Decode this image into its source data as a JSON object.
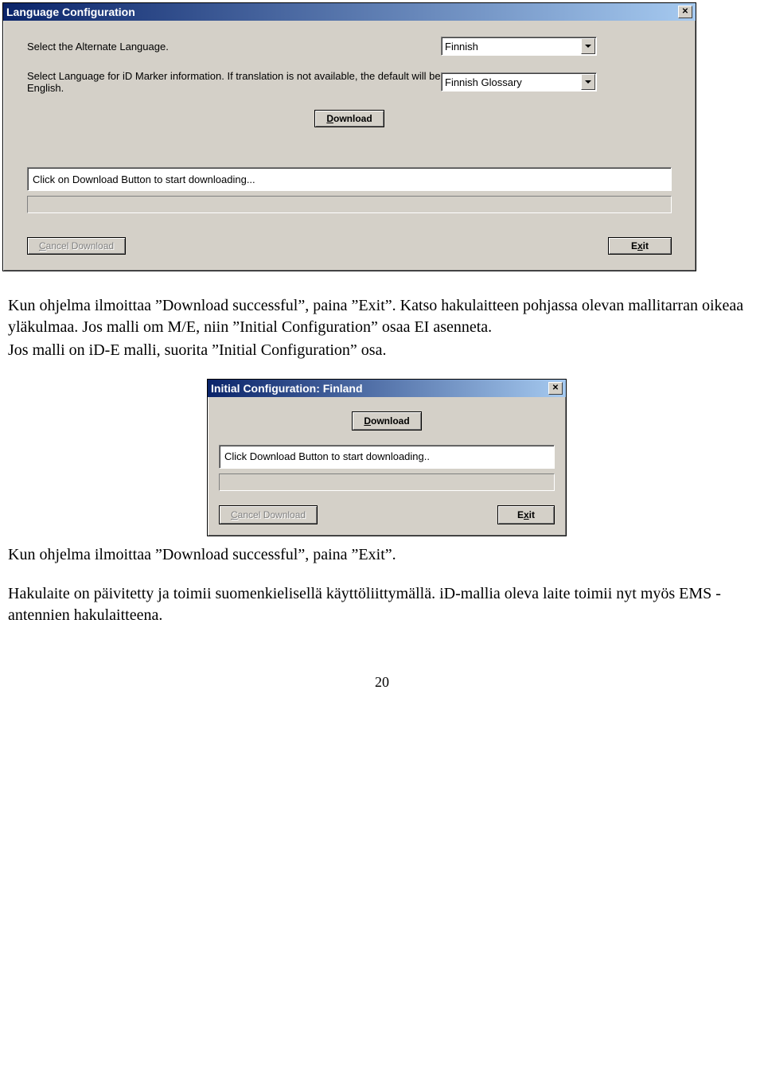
{
  "win1": {
    "title": "Language Configuration",
    "label1": "Select the Alternate Language.",
    "dropdown1": "Finnish",
    "label2": "Select Language for iD Marker information.  If translation is not available, the default will be English.",
    "dropdown2": "Finnish Glossary",
    "download_btn": "ownload",
    "download_btn_prefix": "D",
    "status": "Click on Download Button to start downloading...",
    "cancel_btn": "ancel Download",
    "cancel_btn_prefix": "C",
    "exit_btn": "it",
    "exit_btn_prefix": "Ex"
  },
  "para1": "Kun ohjelma ilmoittaa ”Download successful”, paina ”Exit”. Katso hakulaitteen pohjassa olevan mallitarran oikeaa yläkulmaa. Jos malli om M/E, niin ”Initial Configuration” osaa EI asenneta.",
  "para2": "Jos malli on iD-E malli, suorita ”Initial Configuration” osa.",
  "win2": {
    "title": "Initial Configuration: Finland",
    "download_btn": "ownload",
    "download_btn_prefix": "D",
    "status": "Click Download Button to start downloading..",
    "cancel_btn": "ancel Download",
    "cancel_btn_prefix": "C",
    "exit_btn": "it",
    "exit_btn_prefix": "Ex"
  },
  "para3": "Kun ohjelma ilmoittaa ”Download successful”, paina ”Exit”.",
  "para4": "Hakulaite on päivitetty ja toimii suomenkielisellä  käyttöliittymällä. iD-mallia oleva laite toimii nyt myös EMS -antennien hakulaitteena.",
  "page_num": "20"
}
